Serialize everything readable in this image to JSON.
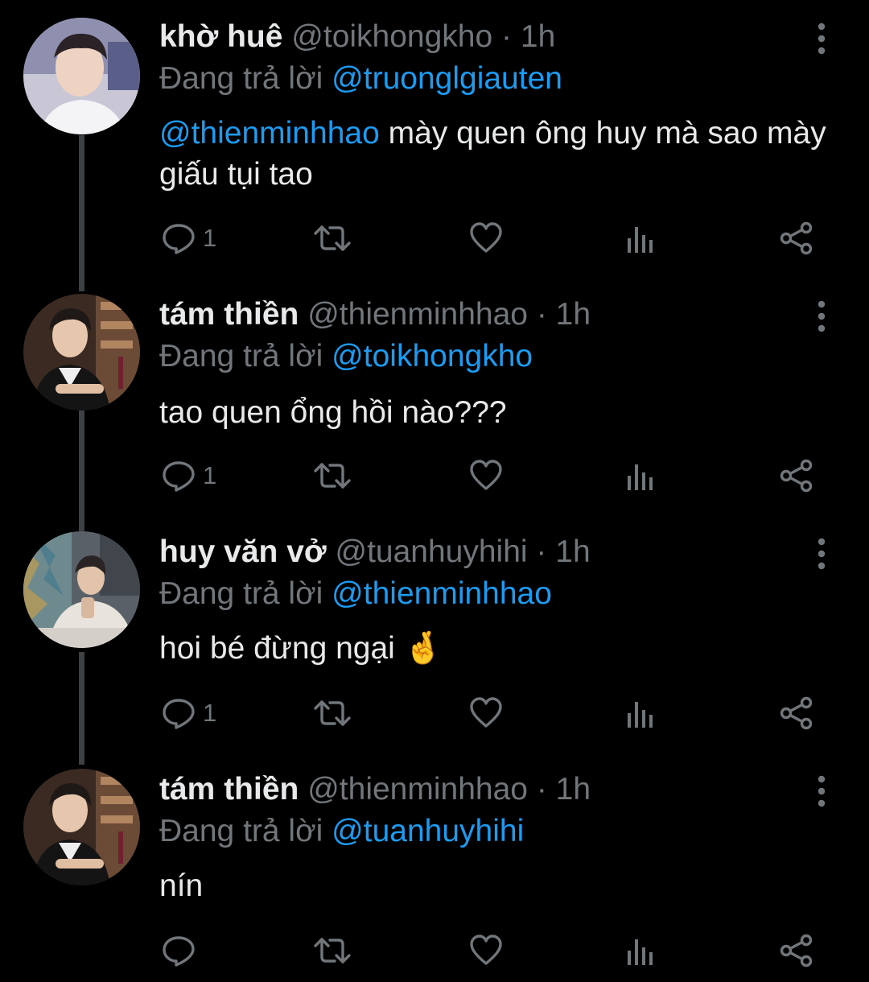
{
  "reply_prefix": "Đang trả lời",
  "separator": "·",
  "colors": {
    "background": "#000000",
    "text_primary": "#e7e9ea",
    "text_secondary": "#71767b",
    "mention": "#1d9bf0",
    "thread_line": "#3e4144"
  },
  "icons": {
    "more": "more-vertical-icon",
    "reply": "reply-bubble-icon",
    "retweet": "retweet-icon",
    "like": "heart-icon",
    "views": "bar-chart-icon",
    "share": "share-icon"
  },
  "tweets": [
    {
      "display_name": "khờ huê",
      "handle": "@toikhongkho",
      "time": "1h",
      "replying_to": "@truonglgiauten",
      "text_mention": "@thienminhhao",
      "text": " mày quen ông huy mà sao mày giấu tụi tao",
      "reply_count": "1"
    },
    {
      "display_name": "tám thiền",
      "handle": "@thienminhhao",
      "time": "1h",
      "replying_to": "@toikhongkho",
      "text_mention": "",
      "text": "tao quen ổng hồi nào???",
      "reply_count": "1"
    },
    {
      "display_name": "huy văn vở",
      "handle": "@tuanhuyhihi",
      "time": "1h",
      "replying_to": "@thienminhhao",
      "text_mention": "",
      "text": "hoi bé đừng ngại 🤞",
      "reply_count": "1"
    },
    {
      "display_name": "tám thiền",
      "handle": "@thienminhhao",
      "time": "1h",
      "replying_to": "@tuanhuyhihi",
      "text_mention": "",
      "text": "nín",
      "reply_count": ""
    }
  ]
}
